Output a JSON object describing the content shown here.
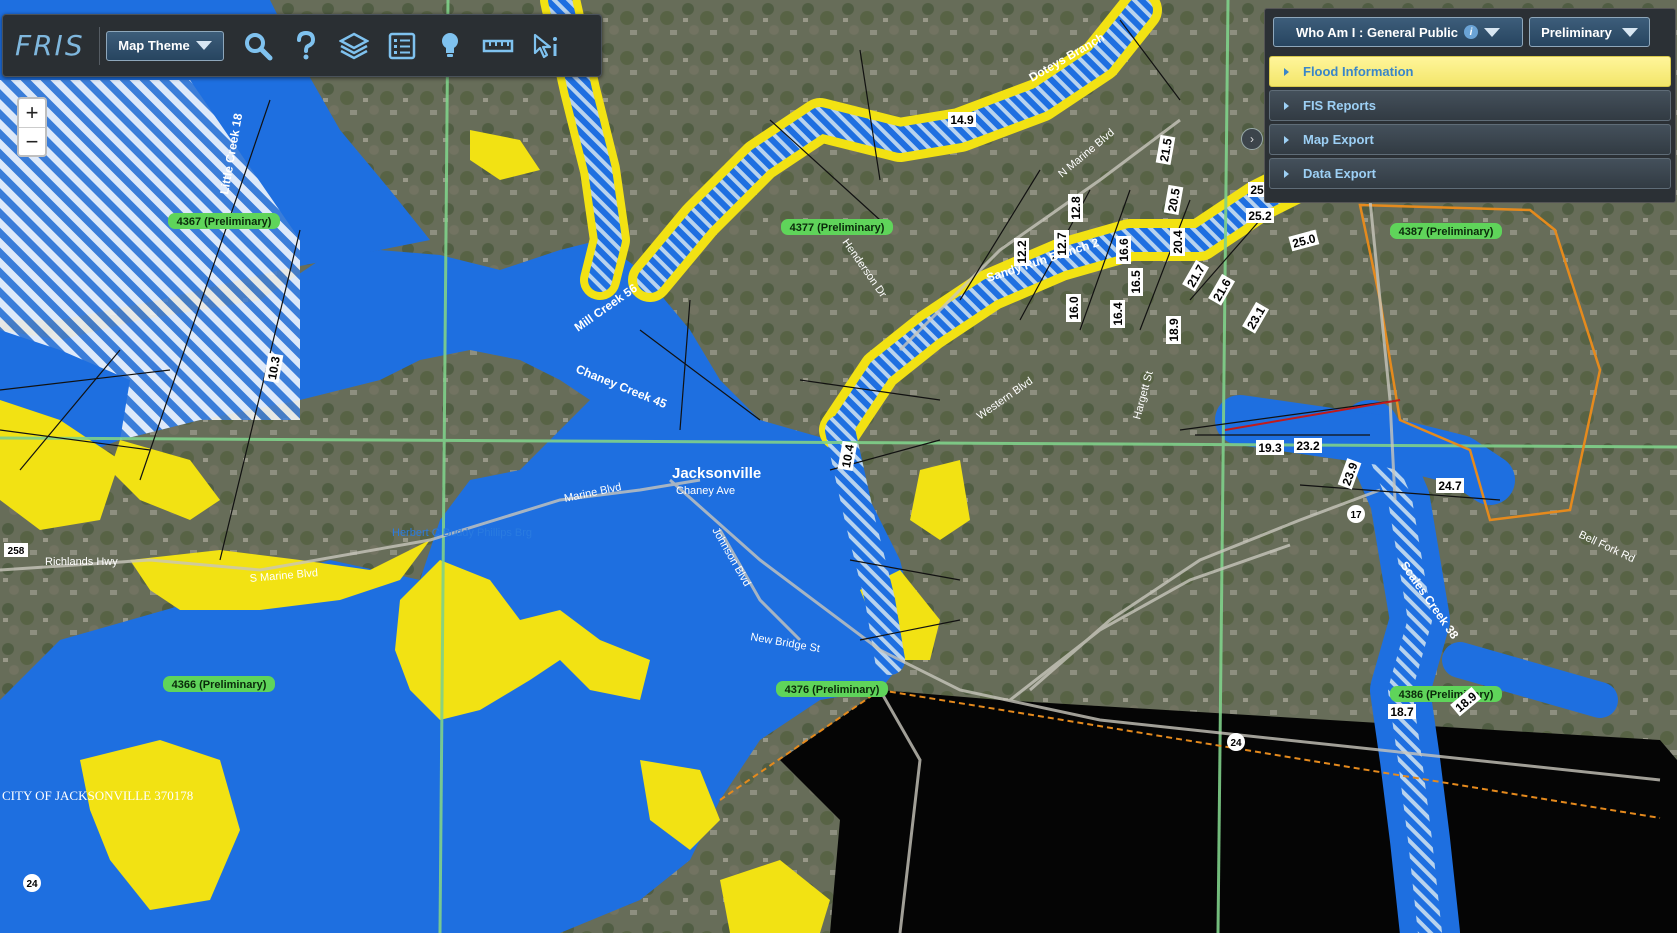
{
  "toolbar": {
    "logo": "FRIS",
    "map_theme_label": "Map Theme",
    "tools": [
      {
        "icon": "search-icon"
      },
      {
        "icon": "help-icon"
      },
      {
        "icon": "layers-icon"
      },
      {
        "icon": "legend-icon"
      },
      {
        "icon": "lightbulb-icon"
      },
      {
        "icon": "measure-icon"
      },
      {
        "icon": "identify-icon"
      }
    ]
  },
  "zoom": {
    "in": "+",
    "out": "−"
  },
  "panel": {
    "who_am_i": "Who Am I : General Public",
    "data_status": "Preliminary",
    "sections": [
      {
        "label": "Flood Information",
        "active": true
      },
      {
        "label": "FIS Reports",
        "active": false
      },
      {
        "label": "Map Export",
        "active": false
      },
      {
        "label": "Data Export",
        "active": false
      }
    ],
    "collapse_icon": "chevron-right-icon"
  },
  "colors": {
    "flood_zone_a": "#1e6fe0",
    "flood_zone_x500": "#f2e213",
    "panel_active": "#f7ec7e",
    "panel_text": "#3a86c8",
    "panel_bg": "#2b3035",
    "panel_grid": "#7fd08a",
    "boundary": "#e58a1d"
  },
  "map": {
    "panels": [
      "4367 (Preliminary)",
      "4377 (Preliminary)",
      "4387 (Preliminary)",
      "4366 (Preliminary)",
      "4376 (Preliminary)",
      "4386 (Preliminary)"
    ],
    "streets": [
      "Richlands Hwy",
      "S Marine Blvd",
      "Marine Blvd",
      "Chaney Ave",
      "Johnson Blvd",
      "N Marine Blvd",
      "Henderson Dr",
      "Bell Fork Rd",
      "Western Blvd",
      "New Bridge St",
      "Hargett St",
      "Richlands Hwy"
    ],
    "streams": [
      "Little Creek 18",
      "Mill Creek 56",
      "Chaney Creek 45",
      "Sandy Run Branch 2",
      "Scales Creek 38",
      "Doteys Branch"
    ],
    "city": "Jacksonville",
    "city_label": "CITY OF JACKSONVILLE 370178",
    "place": "Herbert C Buddy Phillips Brg",
    "bfe_labels": [
      "14.9",
      "10.3",
      "10.4",
      "12.2",
      "12.7",
      "12.8",
      "16.0",
      "16.4",
      "16.5",
      "16.6",
      "18.9",
      "20.4",
      "20.5",
      "21.5",
      "21.6",
      "21.7",
      "23.1",
      "25.0",
      "25.2",
      "25.3",
      "19.3",
      "23.2",
      "23.9",
      "24.7",
      "18.7",
      "18.9",
      "25.8"
    ],
    "routes": [
      "17",
      "24",
      "24",
      "258"
    ]
  }
}
